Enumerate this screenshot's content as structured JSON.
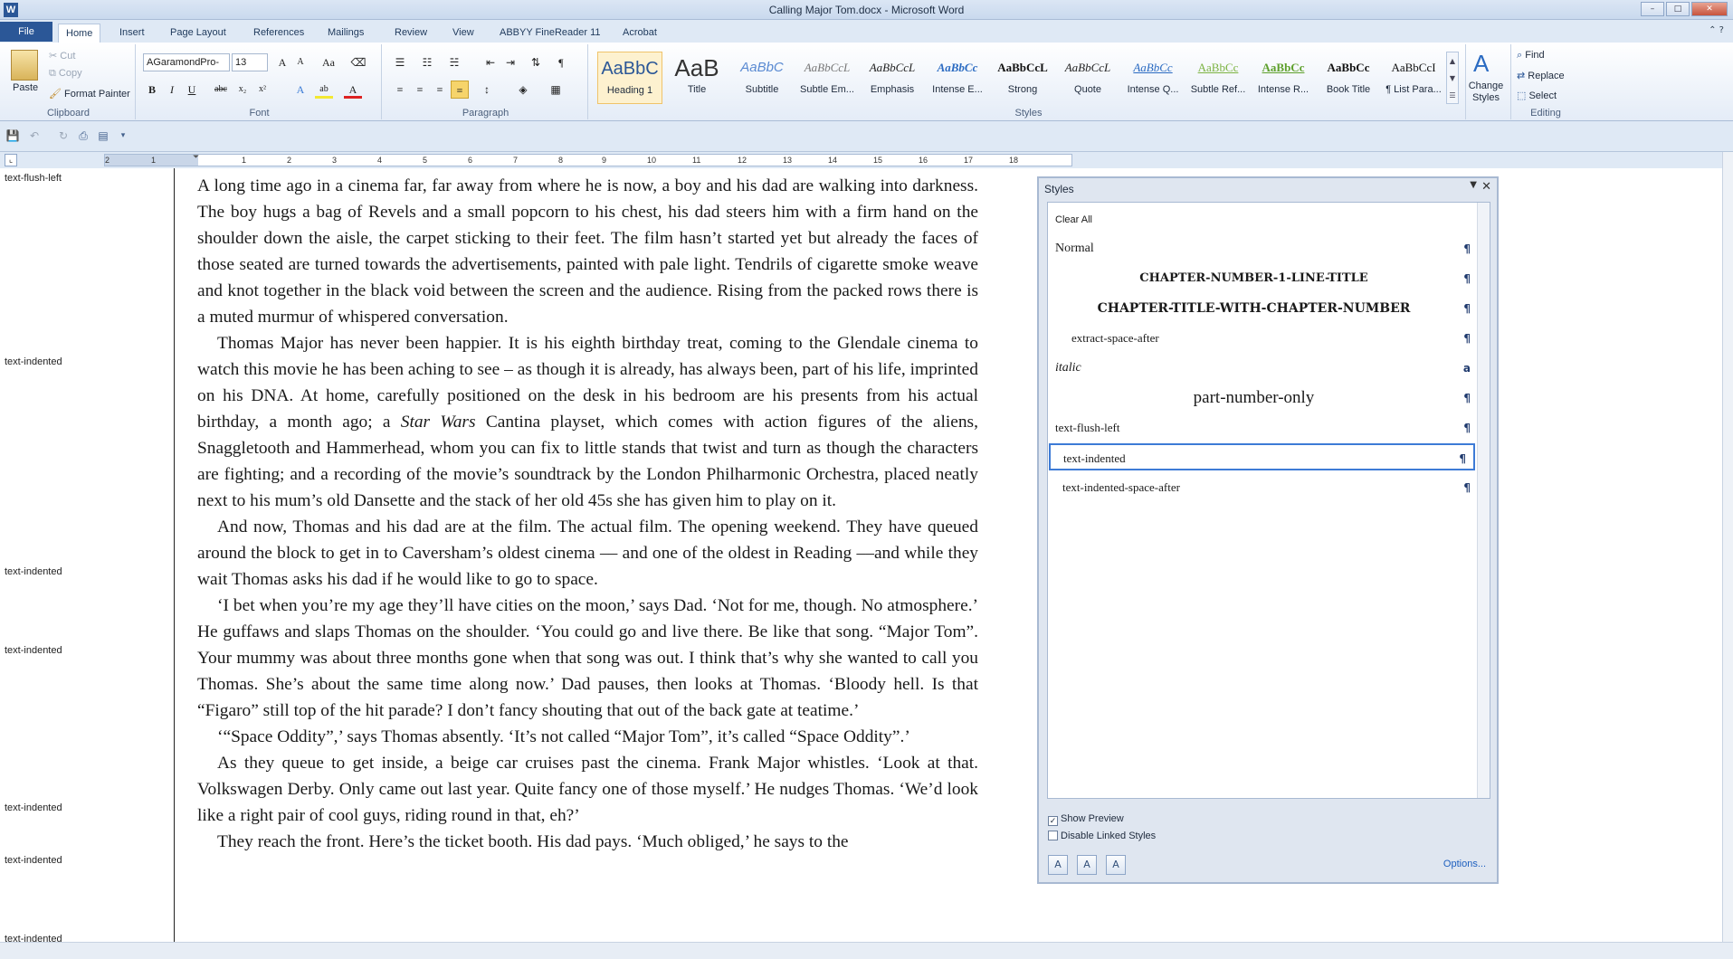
{
  "window": {
    "app_letter": "W",
    "title": "Calling Major Tom.docx - Microsoft Word",
    "minimize": "–",
    "maximize": "□",
    "close": "✕"
  },
  "ribbon_tabs": {
    "file": "File",
    "items": [
      "Home",
      "Insert",
      "Page Layout",
      "References",
      "Mailings",
      "Review",
      "View",
      "ABBYY FineReader 11",
      "Acrobat"
    ],
    "active": "Home"
  },
  "clipboard": {
    "paste": "Paste",
    "cut": "Cut",
    "copy": "Copy",
    "format_painter": "Format Painter",
    "label": "Clipboard"
  },
  "font": {
    "name": "AGaramondPro-",
    "size": "13",
    "label": "Font",
    "bold": "B",
    "italic": "I",
    "underline": "U",
    "strike": "abc",
    "subscript": "x₂",
    "superscript": "x²",
    "grow": "A",
    "shrink": "A",
    "change_case": "Aa",
    "text_effects": "A",
    "highlight": "ab",
    "font_color": "A"
  },
  "paragraph": {
    "label": "Paragraph",
    "pilcrow": "¶"
  },
  "styles_gallery": {
    "label": "Styles",
    "tiles": [
      {
        "preview": "AaBbC",
        "name": "Heading 1"
      },
      {
        "preview": "AaB",
        "name": "Title"
      },
      {
        "preview": "AaBbC",
        "name": "Subtitle"
      },
      {
        "preview": "AaBbCcL",
        "name": "Subtle Em..."
      },
      {
        "preview": "AaBbCcL",
        "name": "Emphasis"
      },
      {
        "preview": "AaBbCc",
        "name": "Intense E..."
      },
      {
        "preview": "AaBbCcL",
        "name": "Strong"
      },
      {
        "preview": "AaBbCcL",
        "name": "Quote"
      },
      {
        "preview": "AaBbCc",
        "name": "Intense Q..."
      },
      {
        "preview": "AaBbCc",
        "name": "Subtle Ref..."
      },
      {
        "preview": "AaBbCc",
        "name": "Intense R..."
      },
      {
        "preview": "AaBbCc",
        "name": "Book Title"
      },
      {
        "preview": "AaBbCcI",
        "name": "¶ List Para..."
      }
    ],
    "change_styles": "Change Styles"
  },
  "editing": {
    "label": "Editing",
    "find": "Find",
    "replace": "Replace",
    "select": "Select"
  },
  "ruler": {
    "ticks": [
      "2",
      "1",
      "1",
      "2",
      "3",
      "4",
      "5",
      "6",
      "7",
      "8",
      "9",
      "10",
      "11",
      "12",
      "13",
      "14",
      "15",
      "16",
      "17",
      "18"
    ]
  },
  "style_area": {
    "labels": [
      "text-flush-left",
      "text-indented",
      "text-indented",
      "text-indented",
      "text-indented",
      "text-indented",
      "text-indented"
    ]
  },
  "document": {
    "paragraphs": [
      "A long time ago in a cinema far, far away from where he is now, a boy and his dad are walking into darkness. The boy hugs a bag of Revels and a small popcorn to his chest, his dad steers him with a firm hand on the shoulder down the aisle, the carpet sticking to their feet. The film hasn’t started yet but already the faces of those seated are turned towards the advertisements, painted with pale light. Tendrils of cigarette smoke weave and knot together in the black void between the screen and the audience. Rising from the packed rows there is a muted murmur of whispered conversation.",
      "Thomas Major has never been happier. It is his eighth birthday treat, coming to the Glendale cinema to watch this movie he has been aching to see – as though it is already, has always been, part of his life, imprinted on his DNA. At home, carefully positioned on the desk in his bedroom are his presents from his actual birthday, a month ago; a",
      "Star Wars",
      "Cantina playset, which comes with action figures of the aliens, Snaggletooth and Hammerhead, whom you can fix to little stands that twist and turn as though the characters are fighting; and a recording of the movie’s soundtrack by the London Philharmonic Orchestra, placed neatly next to his mum’s old Dansette and the stack of her old 45s she has given him to play on it.",
      "And now, Thomas and his dad are at the film. The actual film. The opening weekend. They have queued around the block to get in to Caversham’s oldest cinema –– and one of the oldest in Reading ––and while they wait Thomas asks his dad if he would like to go to space.",
      "‘I bet when you’re my age they’ll have cities on the moon,’ says Dad. ‘Not for me, though. No atmosphere.’ He guffaws and slaps Thomas on the shoulder. ‘You could go and live there. Be like that song. “Major Tom”. Your mummy was about three months gone when that song was out. I think that’s why she wanted to call you Thomas. She’s about the same time along now.’ Dad pauses, then looks at Thomas. ‘Bloody hell. Is that “Figaro” still top of the hit parade? I don’t fancy shouting that out of the back gate at teatime.’",
      "‘“Space Oddity”,’ says Thomas absently. ‘It’s not called “Major Tom”, it’s called “Space Oddity”.’",
      "As they queue to get inside, a beige car cruises past the cinema. Frank Major whistles. ‘Look at that. Volkswagen Derby. Only came out last year. Quite fancy one of those myself.’ He nudges Thomas. ‘We’d look like a right pair of cool guys, riding round in that, eh?’",
      "They reach the front. Here’s the ticket booth. His dad pays. ‘Much obliged,’ he says to the"
    ]
  },
  "styles_pane": {
    "title": "Styles",
    "clear_all": "Clear All",
    "items": [
      {
        "name": "Normal",
        "mark": "¶"
      },
      {
        "name": "CHAPTER-NUMBER-1-LINE-TITLE",
        "mark": "¶"
      },
      {
        "name": "CHAPTER-TITLE-WITH-CHAPTER-NUMBER",
        "mark": "¶"
      },
      {
        "name": "extract-space-after",
        "mark": "¶"
      },
      {
        "name": "italic",
        "mark": "a"
      },
      {
        "name": "part-number-only",
        "mark": "¶"
      },
      {
        "name": "text-flush-left",
        "mark": "¶"
      },
      {
        "name": "text-indented",
        "mark": "¶"
      },
      {
        "name": "text-indented-space-after",
        "mark": "¶"
      }
    ],
    "selected": "text-indented",
    "show_preview": "Show Preview",
    "show_preview_checked": true,
    "disable_linked": "Disable Linked Styles",
    "disable_linked_checked": false,
    "options": "Options..."
  }
}
